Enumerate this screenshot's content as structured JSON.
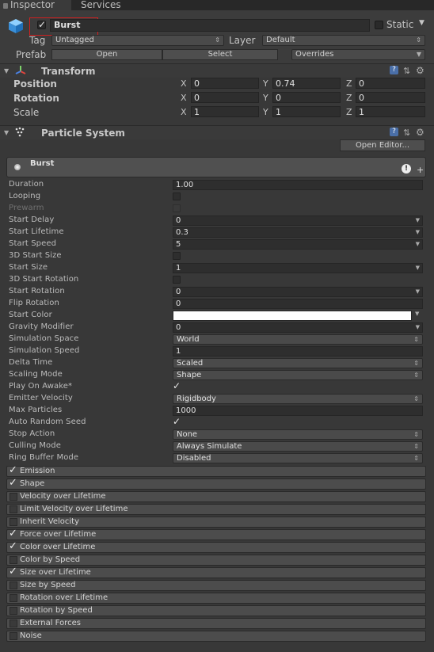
{
  "tabs": {
    "inspector": "Inspector",
    "services": "Services"
  },
  "header": {
    "object_name": "Burst",
    "static_label": "Static",
    "tag_label": "Tag",
    "tag_value": "Untagged",
    "layer_label": "Layer",
    "layer_value": "Default",
    "prefab_label": "Prefab",
    "open_label": "Open",
    "select_label": "Select",
    "overrides_label": "Overrides"
  },
  "transform": {
    "title": "Transform",
    "rows": [
      {
        "label": "Position",
        "x": "0",
        "y": "0.74",
        "z": "0"
      },
      {
        "label": "Rotation",
        "x": "0",
        "y": "0",
        "z": "0"
      },
      {
        "label": "Scale",
        "x": "1",
        "y": "1",
        "z": "1"
      }
    ],
    "axis_x": "X",
    "axis_y": "Y",
    "axis_z": "Z"
  },
  "particle": {
    "title": "Particle System",
    "open_editor": "Open Editor...",
    "system_name": "Burst",
    "props": [
      {
        "label": "Duration",
        "kind": "field",
        "value": "1.00"
      },
      {
        "label": "Looping",
        "kind": "check",
        "checked": false
      },
      {
        "label": "Prewarm",
        "kind": "check",
        "checked": false,
        "disabled": true
      },
      {
        "label": "Start Delay",
        "kind": "field",
        "value": "0",
        "arrow": true
      },
      {
        "label": "Start Lifetime",
        "kind": "field",
        "value": "0.3",
        "arrow": true
      },
      {
        "label": "Start Speed",
        "kind": "field",
        "value": "5",
        "arrow": true
      },
      {
        "label": "3D Start Size",
        "kind": "check",
        "checked": false
      },
      {
        "label": "Start Size",
        "kind": "field",
        "value": "1",
        "arrow": true
      },
      {
        "label": "3D Start Rotation",
        "kind": "check",
        "checked": false
      },
      {
        "label": "Start Rotation",
        "kind": "field",
        "value": "0",
        "arrow": true
      },
      {
        "label": "Flip Rotation",
        "kind": "field",
        "value": "0"
      },
      {
        "label": "Start Color",
        "kind": "color",
        "value": "#ffffff"
      },
      {
        "label": "Gravity Modifier",
        "kind": "field",
        "value": "0",
        "arrow": true
      },
      {
        "label": "Simulation Space",
        "kind": "dropdown",
        "value": "World"
      },
      {
        "label": "Simulation Speed",
        "kind": "field",
        "value": "1"
      },
      {
        "label": "Delta Time",
        "kind": "dropdown",
        "value": "Scaled"
      },
      {
        "label": "Scaling Mode",
        "kind": "dropdown",
        "value": "Shape"
      },
      {
        "label": "Play On Awake*",
        "kind": "tick"
      },
      {
        "label": "Emitter Velocity",
        "kind": "dropdown",
        "value": "Rigidbody"
      },
      {
        "label": "Max Particles",
        "kind": "field",
        "value": "1000"
      },
      {
        "label": "Auto Random Seed",
        "kind": "tick"
      },
      {
        "label": "Stop Action",
        "kind": "dropdown",
        "value": "None"
      },
      {
        "label": "Culling Mode",
        "kind": "dropdown",
        "value": "Always Simulate"
      },
      {
        "label": "Ring Buffer Mode",
        "kind": "dropdown",
        "value": "Disabled"
      }
    ],
    "modules": [
      {
        "label": "Emission",
        "checked": true
      },
      {
        "label": "Shape",
        "checked": true
      },
      {
        "label": "Velocity over Lifetime",
        "checked": false
      },
      {
        "label": "Limit Velocity over Lifetime",
        "checked": false
      },
      {
        "label": "Inherit Velocity",
        "checked": false
      },
      {
        "label": "Force over Lifetime",
        "checked": true
      },
      {
        "label": "Color over Lifetime",
        "checked": true
      },
      {
        "label": "Color by Speed",
        "checked": false
      },
      {
        "label": "Size over Lifetime",
        "checked": true
      },
      {
        "label": "Size by Speed",
        "checked": false
      },
      {
        "label": "Rotation over Lifetime",
        "checked": false
      },
      {
        "label": "Rotation by Speed",
        "checked": false
      },
      {
        "label": "External Forces",
        "checked": false
      },
      {
        "label": "Noise",
        "checked": false
      }
    ]
  }
}
